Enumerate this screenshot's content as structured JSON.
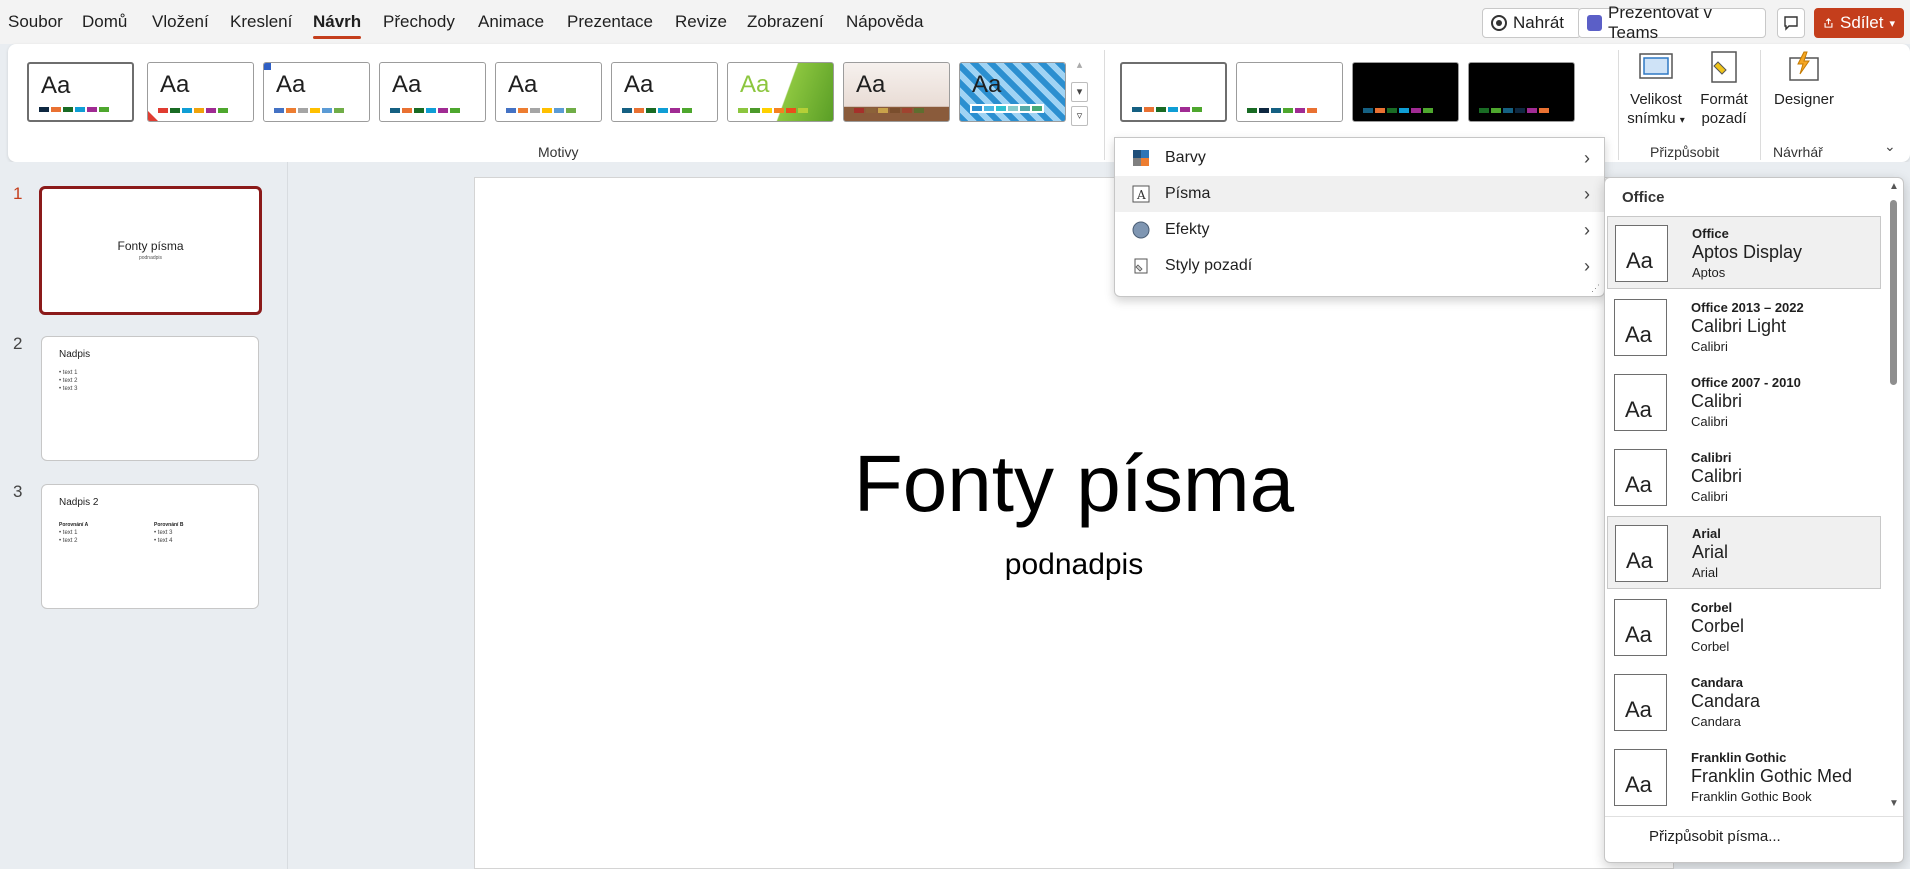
{
  "menubar": {
    "tabs": [
      "Soubor",
      "Domů",
      "Vložení",
      "Kreslení",
      "Návrh",
      "Přechody",
      "Animace",
      "Prezentace",
      "Revize",
      "Zobrazení",
      "Nápověda"
    ],
    "active_tab": "Návrh",
    "record_label": "Nahrát",
    "teams_label": "Prezentovat v Teams",
    "share_label": "Sdílet"
  },
  "ribbon": {
    "themes_group_label": "Motivy",
    "themes_aa": "Aa",
    "customize_group_label": "Přizpůsobit",
    "designer_group_label": "Návrhář",
    "slide_size_line1": "Velikost",
    "slide_size_line2": "snímku",
    "format_bg_line1": "Formát",
    "format_bg_line2": "pozadí",
    "designer_label": "Designer"
  },
  "slides_panel": {
    "slides": [
      {
        "num": "1",
        "title": "Fonty písma",
        "subtitle": "podnadpis"
      },
      {
        "num": "2",
        "title": "Nadpis",
        "bullets": [
          "text 1",
          "text 2",
          "text 3"
        ]
      },
      {
        "num": "3",
        "title": "Nadpis 2",
        "col1_head": "Porovnání A",
        "col1": [
          "text 1",
          "text 2"
        ],
        "col2_head": "Porovnání B",
        "col2": [
          "text 3",
          "text 4"
        ]
      }
    ]
  },
  "slide": {
    "title": "Fonty písma",
    "subtitle": "podnadpis"
  },
  "variant_menu": {
    "items": [
      "Barvy",
      "Písma",
      "Efekty",
      "Styly pozadí"
    ]
  },
  "fonts_menu": {
    "header": "Office",
    "aa": "Aa",
    "entries": [
      {
        "name": "Office",
        "heading": "Aptos Display",
        "body": "Aptos"
      },
      {
        "name": "Office 2013 – 2022",
        "heading": "Calibri Light",
        "body": "Calibri"
      },
      {
        "name": "Office 2007 - 2010",
        "heading": "Calibri",
        "body": "Calibri"
      },
      {
        "name": "Calibri",
        "heading": "Calibri",
        "body": "Calibri"
      },
      {
        "name": "Arial",
        "heading": "Arial",
        "body": "Arial"
      },
      {
        "name": "Corbel",
        "heading": "Corbel",
        "body": "Corbel"
      },
      {
        "name": "Candara",
        "heading": "Candara",
        "body": "Candara"
      },
      {
        "name": "Franklin Gothic",
        "heading": "Franklin Gothic Med",
        "body": "Franklin Gothic Book"
      }
    ],
    "customize_label": "Přizpůsobit písma..."
  },
  "colors": {
    "accent": "#c43e1c",
    "active_slide_border": "#8b1a1a"
  }
}
